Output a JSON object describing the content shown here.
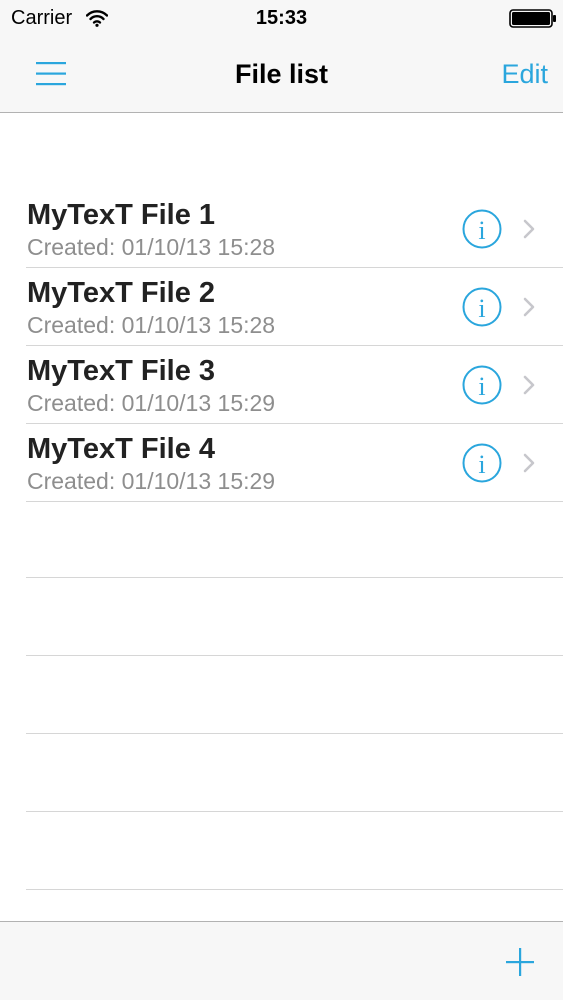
{
  "status_bar": {
    "carrier": "Carrier",
    "time": "15:33",
    "wifi_icon": "wifi-icon",
    "battery_icon": "battery-icon"
  },
  "nav_bar": {
    "title": "File list",
    "edit_label": "Edit",
    "menu_icon": "hamburger-menu-icon"
  },
  "files": [
    {
      "name": "MyTexT File 1",
      "created": "Created: 01/10/13 15:28"
    },
    {
      "name": "MyTexT File 2",
      "created": "Created: 01/10/13 15:28"
    },
    {
      "name": "MyTexT File 3",
      "created": "Created: 01/10/13 15:29"
    },
    {
      "name": "MyTexT File 4",
      "created": "Created: 01/10/13 15:29"
    }
  ],
  "toolbar": {
    "add_icon": "plus-icon"
  },
  "colors": {
    "accent": "#2aa6dd",
    "bar_background": "#f7f7f7",
    "separator": "#d6d6d6",
    "subtitle": "#8e8e8e"
  }
}
